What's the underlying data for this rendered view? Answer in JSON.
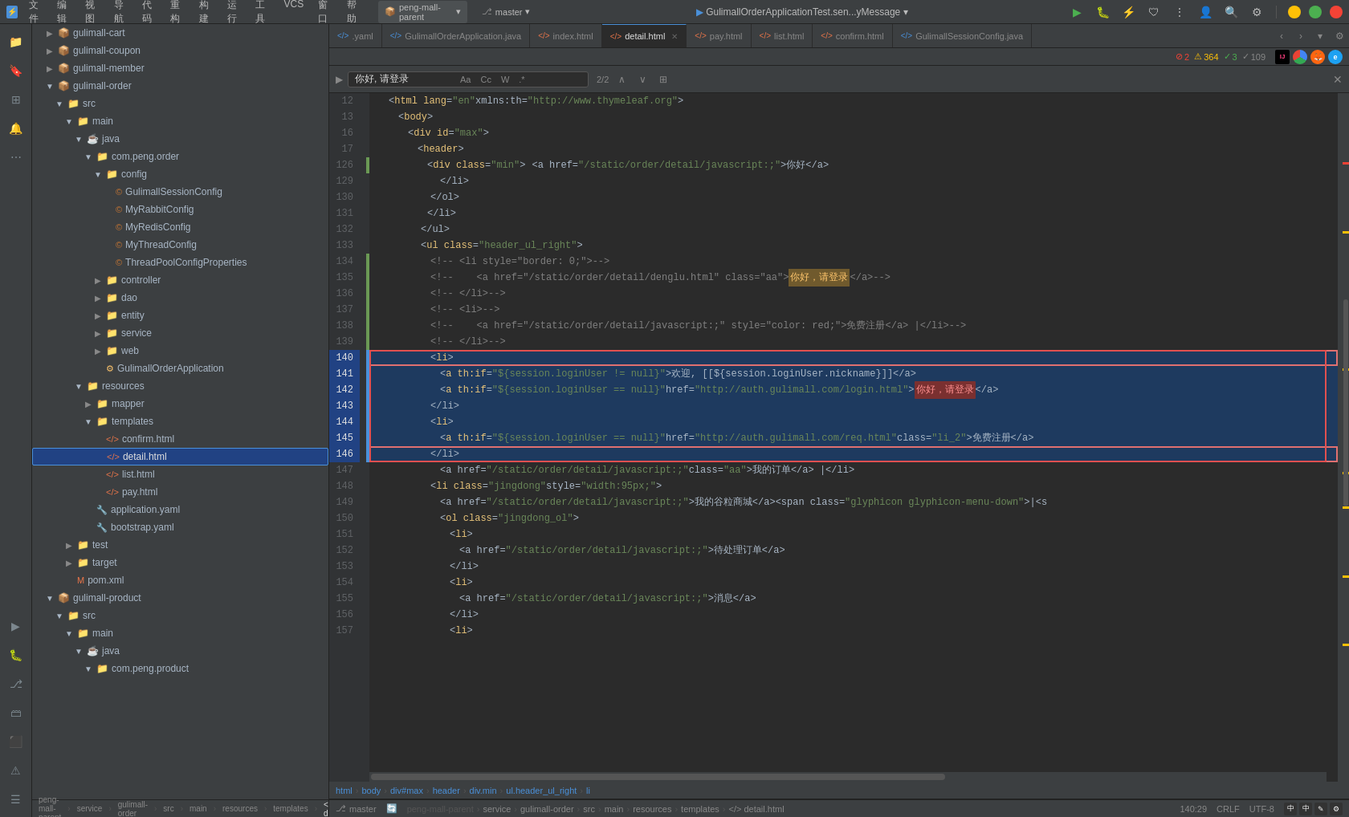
{
  "titlebar": {
    "app_icon": "⚡",
    "menu_items": [
      "文件",
      "编辑",
      "视图",
      "导航",
      "代码",
      "重构",
      "构建",
      "运行",
      "工具",
      "VCS",
      "窗口",
      "帮助"
    ],
    "project_name": "peng-mall-parent",
    "branch_name": "master",
    "title": "GulimallOrderApplicationTest.sen...yMessage",
    "run_btn": "▶",
    "debug_btn": "🐛",
    "profile_btn": "👤",
    "search_btn": "🔍",
    "settings_btn": "⚙",
    "minimize": "—",
    "maximize": "□",
    "close": "✕"
  },
  "tabs": [
    {
      "id": "yaml",
      "label": ".yaml",
      "icon": "<>",
      "type": "yaml",
      "active": false,
      "closable": false
    },
    {
      "id": "application-java",
      "label": "GulimallOrderApplication.java",
      "icon": "<>",
      "type": "java",
      "active": false,
      "closable": false
    },
    {
      "id": "index-html",
      "label": "index.html",
      "icon": "<>",
      "type": "html",
      "active": false,
      "closable": false
    },
    {
      "id": "detail-html",
      "label": "detail.html",
      "icon": "<>",
      "type": "html",
      "active": true,
      "closable": true
    },
    {
      "id": "pay-html",
      "label": "pay.html",
      "icon": "<>",
      "type": "html",
      "active": false,
      "closable": false
    },
    {
      "id": "list-html",
      "label": "list.html",
      "icon": "<>",
      "type": "html",
      "active": false,
      "closable": false
    },
    {
      "id": "confirm-html",
      "label": "confirm.html",
      "icon": "<>",
      "type": "html",
      "active": false,
      "closable": false
    },
    {
      "id": "session-config",
      "label": "GulimallSessionConfig.java",
      "icon": "<>",
      "type": "java",
      "active": false,
      "closable": false
    }
  ],
  "search": {
    "placeholder": "你好, 请登录",
    "value": "你好, 请登录",
    "count": "2/2",
    "options": [
      "Aa",
      "Cc",
      "W",
      ".*"
    ],
    "close_btn": "✕"
  },
  "indicators": {
    "errors": "2",
    "warnings": "364",
    "ok": "3",
    "info": "109"
  },
  "breadcrumb": {
    "items": [
      "html",
      "body",
      "div#max",
      "header",
      "div.min",
      "ul.header_ul_right",
      "li"
    ]
  },
  "status_bar": {
    "project_path": "peng-mall-parent",
    "service": "service",
    "order": "gulimall-order",
    "src": "src",
    "main": "main",
    "resources": "resources",
    "templates": "templates",
    "file": "detail.html",
    "position": "140:29",
    "encoding": "CRLF",
    "charset": "UTF-8"
  },
  "file_tree": {
    "items": [
      {
        "id": "gulimall-cart",
        "label": "gulimall-cart",
        "type": "module",
        "indent": 1,
        "expanded": false
      },
      {
        "id": "gulimall-coupon",
        "label": "gulimall-coupon",
        "type": "module",
        "indent": 1,
        "expanded": false
      },
      {
        "id": "gulimall-member",
        "label": "gulimall-member",
        "type": "module",
        "indent": 1,
        "expanded": false
      },
      {
        "id": "gulimall-order",
        "label": "gulimall-order",
        "type": "module",
        "indent": 1,
        "expanded": true
      },
      {
        "id": "src",
        "label": "src",
        "type": "folder",
        "indent": 2,
        "expanded": true
      },
      {
        "id": "main",
        "label": "main",
        "type": "folder",
        "indent": 3,
        "expanded": true
      },
      {
        "id": "java",
        "label": "java",
        "type": "folder",
        "indent": 4,
        "expanded": true
      },
      {
        "id": "com-peng-order",
        "label": "com.peng.order",
        "type": "package",
        "indent": 5,
        "expanded": true
      },
      {
        "id": "config",
        "label": "config",
        "type": "folder",
        "indent": 6,
        "expanded": true
      },
      {
        "id": "GulimallSessionConfig",
        "label": "GulimallSessionConfig",
        "type": "java",
        "indent": 7
      },
      {
        "id": "MyRabbitConfig",
        "label": "MyRabbitConfig",
        "type": "java",
        "indent": 7
      },
      {
        "id": "MyRedisConfig",
        "label": "MyRedisConfig",
        "type": "java",
        "indent": 7
      },
      {
        "id": "MyThreadConfig",
        "label": "MyThreadConfig",
        "type": "java",
        "indent": 7
      },
      {
        "id": "ThreadPoolConfigProperties",
        "label": "ThreadPoolConfigProperties",
        "type": "java",
        "indent": 7
      },
      {
        "id": "controller",
        "label": "controller",
        "type": "folder",
        "indent": 6,
        "expanded": false
      },
      {
        "id": "dao",
        "label": "dao",
        "type": "folder",
        "indent": 6,
        "expanded": false
      },
      {
        "id": "entity",
        "label": "entity",
        "type": "folder",
        "indent": 6,
        "expanded": false
      },
      {
        "id": "service",
        "label": "service",
        "type": "folder",
        "indent": 6,
        "expanded": false
      },
      {
        "id": "web",
        "label": "web",
        "type": "folder",
        "indent": 6,
        "expanded": false
      },
      {
        "id": "GulimallOrderApplication",
        "label": "GulimallOrderApplication",
        "type": "java",
        "indent": 6
      },
      {
        "id": "resources",
        "label": "resources",
        "type": "folder",
        "indent": 4,
        "expanded": true
      },
      {
        "id": "mapper",
        "label": "mapper",
        "type": "folder",
        "indent": 5,
        "expanded": false
      },
      {
        "id": "templates",
        "label": "templates",
        "type": "folder",
        "indent": 5,
        "expanded": true
      },
      {
        "id": "confirm-html",
        "label": "confirm.html",
        "type": "html",
        "indent": 6
      },
      {
        "id": "detail-html-file",
        "label": "detail.html",
        "type": "html",
        "indent": 6,
        "active": true
      },
      {
        "id": "list-html-file",
        "label": "list.html",
        "type": "html",
        "indent": 6
      },
      {
        "id": "pay-html-file",
        "label": "pay.html",
        "type": "html",
        "indent": 6
      },
      {
        "id": "application-yaml",
        "label": "application.yaml",
        "type": "yaml",
        "indent": 5
      },
      {
        "id": "bootstrap-yaml",
        "label": "bootstrap.yaml",
        "type": "yaml",
        "indent": 5
      },
      {
        "id": "test",
        "label": "test",
        "type": "folder",
        "indent": 3,
        "expanded": false
      },
      {
        "id": "target",
        "label": "target",
        "type": "folder",
        "indent": 3,
        "expanded": false
      },
      {
        "id": "pom-xml",
        "label": "pom.xml",
        "type": "xml",
        "indent": 3
      },
      {
        "id": "gulimall-product",
        "label": "gulimall-product",
        "type": "module",
        "indent": 1,
        "expanded": true
      },
      {
        "id": "src2",
        "label": "src",
        "type": "folder",
        "indent": 2,
        "expanded": true
      },
      {
        "id": "main2",
        "label": "main",
        "type": "folder",
        "indent": 3,
        "expanded": true
      },
      {
        "id": "java2",
        "label": "java",
        "type": "folder",
        "indent": 4,
        "expanded": true
      },
      {
        "id": "com-peng-product",
        "label": "com.peng.product",
        "type": "package",
        "indent": 5,
        "expanded": true
      }
    ]
  },
  "code_lines": [
    {
      "num": 12,
      "type": "normal",
      "indent": 8,
      "content": "<body>"
    },
    {
      "num": 13,
      "type": "normal",
      "indent": 12,
      "content": "<div id=\"max\">"
    },
    {
      "num": 16,
      "type": "normal",
      "indent": 16,
      "content": "<header>"
    },
    {
      "num": 17,
      "type": "normal",
      "indent": 20,
      "content": "<div class=\"min\">"
    },
    {
      "num": 126,
      "type": "normal",
      "indent": 24,
      "content": "<a href=\"/static/order/detail/javascript:;\" >你好</a>"
    },
    {
      "num": 129,
      "type": "normal",
      "indent": 24,
      "content": "</li>"
    },
    {
      "num": 130,
      "type": "normal",
      "indent": 20,
      "content": "</ol>"
    },
    {
      "num": 131,
      "type": "normal",
      "indent": 20,
      "content": "</li>"
    },
    {
      "num": 132,
      "type": "normal",
      "indent": 16,
      "content": "</ul>"
    },
    {
      "num": 133,
      "type": "normal",
      "indent": 16,
      "content": "<ul class=\"header_ul_right\">"
    },
    {
      "num": 134,
      "type": "comment",
      "indent": 20,
      "content": "<!-- <li style=\"border: 0;\">-->"
    },
    {
      "num": 135,
      "type": "comment",
      "indent": 20,
      "content": "<!--    <a href=\"/static/order/detail/denglu.html\" class=\"aa\">你好，请登录</a>-->"
    },
    {
      "num": 136,
      "type": "comment",
      "indent": 20,
      "content": "<!-- </li>-->"
    },
    {
      "num": 137,
      "type": "comment",
      "indent": 20,
      "content": "<!-- <li>-->"
    },
    {
      "num": 138,
      "type": "comment",
      "indent": 20,
      "content": "<!--    <a href=\"/static/order/detail/javascript:;\" style=\"color: red;\">免费注册</a> |</li>-->"
    },
    {
      "num": 139,
      "type": "comment",
      "indent": 20,
      "content": "<!-- </li>-->"
    },
    {
      "num": 140,
      "type": "selected",
      "indent": 20,
      "content": "<li>"
    },
    {
      "num": 141,
      "type": "selected",
      "indent": 24,
      "content": "<a th:if=\"${session.loginUser != null}\" >欢迎, [[${session.loginUser.nickname}]]</a>"
    },
    {
      "num": 142,
      "type": "selected",
      "indent": 24,
      "content": "<a th:if=\"${session.loginUser == null}\" href=\"http://auth.gulimall.com/login.html\" >你好，请登录</a>"
    },
    {
      "num": 143,
      "type": "selected",
      "indent": 20,
      "content": "</li>"
    },
    {
      "num": 144,
      "type": "selected",
      "indent": 20,
      "content": "<li>"
    },
    {
      "num": 145,
      "type": "selected",
      "indent": 24,
      "content": "<a th:if=\"${session.loginUser == null}\" href=\"http://auth.gulimall.com/req.html\" class=\"li_2\">免费注册</a>"
    },
    {
      "num": 146,
      "type": "selected",
      "indent": 20,
      "content": "</li>"
    },
    {
      "num": 147,
      "type": "normal",
      "indent": 24,
      "content": "<a href=\"/static/order/detail/javascript:;\" class=\"aa\">我的订单</a> |</li>"
    },
    {
      "num": 148,
      "type": "normal",
      "indent": 20,
      "content": "<li class=\"jingdong\" style=\"width:95px;\">"
    },
    {
      "num": 149,
      "type": "normal",
      "indent": 24,
      "content": "<a href=\"/static/order/detail/javascript:;\">我的谷粒商城</a><span class=\"glyphicon glyphicon-menu-down\">|<s"
    },
    {
      "num": 150,
      "type": "normal",
      "indent": 24,
      "content": "<ol class=\"jingdong_ol\">"
    },
    {
      "num": 151,
      "type": "normal",
      "indent": 28,
      "content": "<li>"
    },
    {
      "num": 152,
      "type": "normal",
      "indent": 32,
      "content": "<a href=\"/static/order/detail/javascript:;\">待处理订单</a>"
    },
    {
      "num": 153,
      "type": "normal",
      "indent": 28,
      "content": "</li>"
    },
    {
      "num": 154,
      "type": "normal",
      "indent": 28,
      "content": "<li>"
    },
    {
      "num": 155,
      "type": "normal",
      "indent": 32,
      "content": "<a href=\"/static/order/detail/javascript:;\">消息</a>"
    },
    {
      "num": 156,
      "type": "normal",
      "indent": 28,
      "content": "</li>"
    },
    {
      "num": 157,
      "type": "normal",
      "indent": 28,
      "content": "<li>"
    }
  ]
}
